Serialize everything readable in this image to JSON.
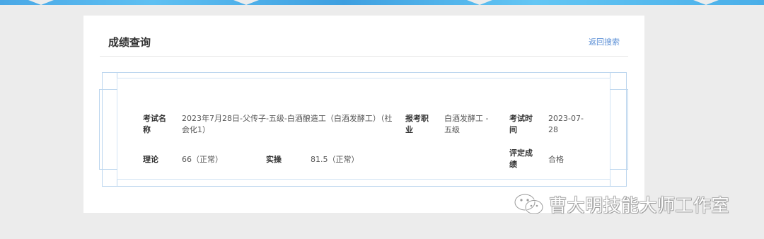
{
  "card": {
    "title": "成绩查询",
    "back_link": "返回搜索"
  },
  "result": {
    "exam_name_label": "考试名称",
    "exam_name_value": "2023年7月28日-父传子-五级-白酒酿造工（白酒发酵工）（社会化1）",
    "job_label": "报考职业",
    "job_value": "白酒发酵工 - 五级",
    "exam_time_label": "考试时间",
    "exam_time_value": "2023-07-28",
    "theory_label": "理论",
    "theory_value": "66（正常）",
    "practice_label": "实操",
    "practice_value": "81.5（正常）",
    "rating_label": "评定成绩",
    "rating_value": "合格"
  },
  "watermark": {
    "text": "曹大明技能大师工作室",
    "icon": "wechat-icon"
  }
}
